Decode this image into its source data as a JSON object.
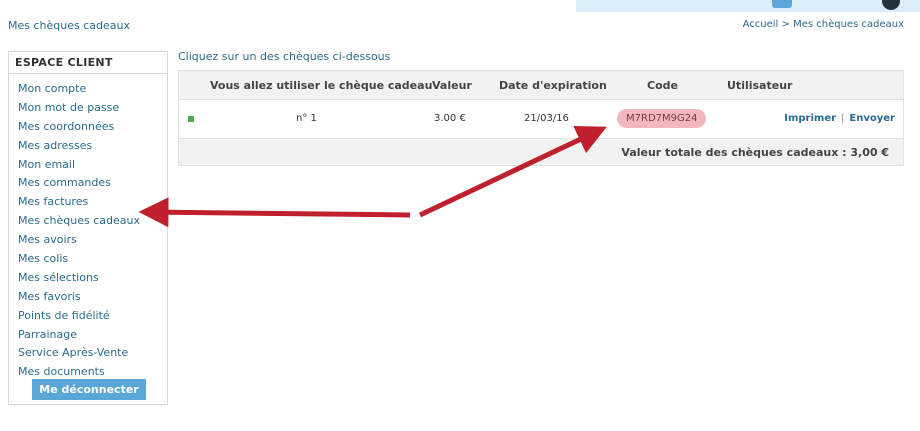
{
  "header": {
    "page_title": "Mes chèques cadeaux",
    "breadcrumb": {
      "home": "Accueil",
      "separator": ">",
      "current": "Mes chèques cadeaux"
    }
  },
  "sidebar": {
    "title": "ESPACE CLIENT",
    "items": [
      {
        "label": "Mon compte"
      },
      {
        "label": "Mon mot de passe"
      },
      {
        "label": "Mes coordonnées"
      },
      {
        "label": "Mes adresses"
      },
      {
        "label": "Mon email"
      },
      {
        "label": "Mes commandes"
      },
      {
        "label": "Mes factures"
      },
      {
        "label": "Mes chèques cadeaux"
      },
      {
        "label": "Mes avoirs"
      },
      {
        "label": "Mes colis"
      },
      {
        "label": "Mes sélections"
      },
      {
        "label": "Mes favoris"
      },
      {
        "label": "Points de fidélité"
      },
      {
        "label": "Parrainage"
      },
      {
        "label": "Service Après-Vente"
      },
      {
        "label": "Mes documents"
      }
    ],
    "logout_label": "Me déconnecter"
  },
  "main": {
    "instructions": "Cliquez sur un des chèques ci-dessous",
    "table": {
      "columns": [
        "Vous allez utiliser le chèque cadeau",
        "Valeur",
        "Date d'expiration",
        "Code",
        "Utilisateur"
      ],
      "rows": [
        {
          "number": "n° 1",
          "value": "3.00 €",
          "expiration": "21/03/16",
          "code": "M7RD7M9G24",
          "user": "",
          "actions": {
            "print": "Imprimer",
            "separator": "|",
            "send": "Envoyer"
          }
        }
      ],
      "total": "Valeur totale des chèques cadeaux : 3,00 €"
    }
  },
  "colors": {
    "link": "#2a6b8e",
    "button": "#5aa6d6",
    "badge": "#f2b8bf",
    "arrow": "#c0202e",
    "header_bg": "#f2f2f2"
  }
}
